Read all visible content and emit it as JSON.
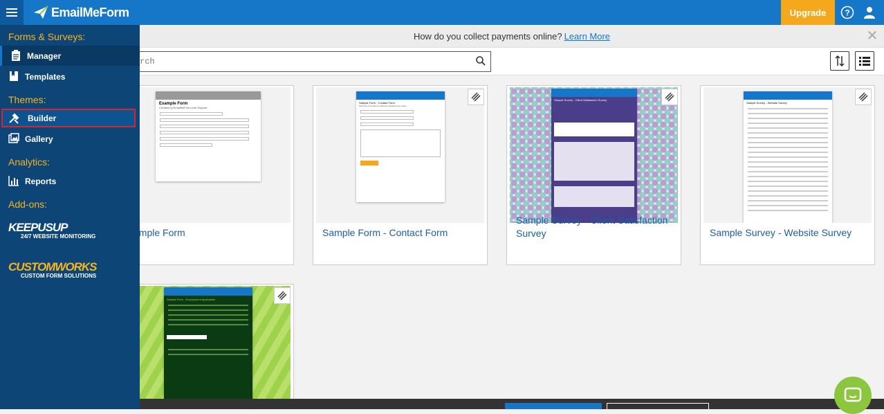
{
  "header": {
    "app_name": "EmailMeForm",
    "upgrade_label": "Upgrade",
    "help_icon": "question-circle-icon",
    "account_icon": "user-icon"
  },
  "banner": {
    "text": "How do you collect payments online?",
    "link": "Learn More"
  },
  "toolbar": {
    "search_placeholder": "rch"
  },
  "sidebar": {
    "sections": [
      {
        "label": "Forms & Surveys:",
        "items": [
          {
            "label": "Manager"
          },
          {
            "label": "Templates"
          }
        ]
      },
      {
        "label": "Themes:",
        "items": [
          {
            "label": "Builder"
          },
          {
            "label": "Gallery"
          }
        ]
      },
      {
        "label": "Analytics:",
        "items": [
          {
            "label": "Reports"
          }
        ]
      },
      {
        "label": "Add-ons:",
        "items": []
      }
    ],
    "addons": [
      {
        "brand": "KEEPUSUP",
        "tagline": "24/7 WEBSITE MONITORING"
      },
      {
        "brand": "CUSTOMWORKS",
        "tagline": "CUSTOM FORM SOLUTIONS"
      }
    ]
  },
  "templates": [
    {
      "title": "xample Form",
      "thumb_title": "Example Form",
      "thumb_sub": "Created by EmailMeForm.com Support"
    },
    {
      "title": "Sample Form - Contact Form",
      "thumb_title": "Sample Form - Contact Form",
      "thumb_sub": "Feel free to contact us with any questions you have."
    },
    {
      "title": "Sample Survey - Client Satisfaction Survey",
      "thumb_title": "Sample Survey - Client Satisfaction Survey"
    },
    {
      "title": "Sample Survey - Website Survey",
      "thumb_title": "Sample Survey - Website Survey"
    },
    {
      "title": "",
      "thumb_title": "Sample Form - Employment Application"
    }
  ],
  "colors": {
    "primary": "#1676c8",
    "sidebar": "#0d4577",
    "accent": "#f7b51e",
    "upgrade": "#f5a81c",
    "highlight": "#d9232e"
  }
}
